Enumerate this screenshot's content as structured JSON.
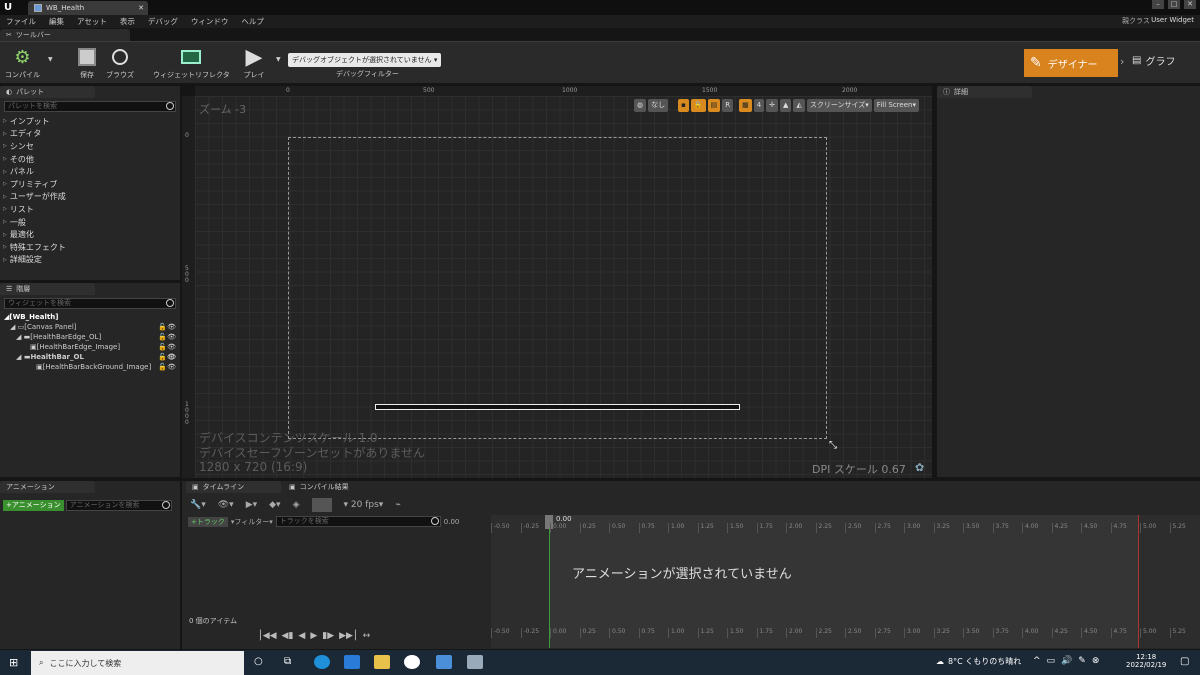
{
  "window": {
    "tab_title": "WB_Health",
    "parent_class": "親クラス",
    "user_widget": "User Widget",
    "controls": [
      "–",
      "□",
      "✕"
    ]
  },
  "menu": [
    "ファイル",
    "編集",
    "アセット",
    "表示",
    "デバッグ",
    "ウィンドウ",
    "ヘルプ"
  ],
  "toolbar": {
    "header": "ツールバー",
    "compile": "コンパイル",
    "save": "保存",
    "browse": "ブラウズ",
    "reflector": "ウィジェットリフレクタ",
    "play": "プレイ",
    "debug_select": "デバッグオブジェクトが選択されていません",
    "debug_filter": "デバッグフィルター",
    "designer": "デザイナー",
    "graph": "グラフ"
  },
  "palette": {
    "title": "パレット",
    "search_placeholder": "パレットを検索",
    "categories": [
      "インプット",
      "エディタ",
      "シンセ",
      "その他",
      "パネル",
      "プリミティブ",
      "ユーザーが作成",
      "リスト",
      "一般",
      "最適化",
      "特殊エフェクト",
      "詳細設定"
    ]
  },
  "hierarchy": {
    "title": "階層",
    "search_placeholder": "ウィジェットを検索",
    "items": [
      "[WB_Health]",
      "[Canvas Panel]",
      "[HealthBarEdge_OL]",
      "[HealthBarEdge_Image]",
      "HealthBar_OL",
      "[HealthBarBackGround_Image]"
    ]
  },
  "canvas": {
    "zoom": "ズーム -3",
    "ruler_x": [
      "0",
      "500",
      "1000",
      "1500",
      "2000"
    ],
    "ruler_y": [
      "0",
      "500",
      "1000"
    ],
    "content_scale": "デバイスコンテンツスケール 1.0",
    "safe_zone": "デバイスセーフゾーンセットがありません",
    "resolution": "1280 x 720 (16:9)",
    "dpi": "DPI スケール 0.67",
    "none": "なし",
    "r_label": "R",
    "count": "4",
    "screen_size": "スクリーンサイズ",
    "fill_screen": "Fill Screen"
  },
  "details": {
    "title": "詳細"
  },
  "animations": {
    "title": "アニメーション",
    "add_button": "+アニメーション",
    "search_placeholder": "アニメーションを検索"
  },
  "timeline": {
    "tab_timeline": "タイムライン",
    "tab_compile": "コンパイル結果",
    "fps": "20 fps",
    "track": "+トラック",
    "filter": "フィルター",
    "track_search": "トラックを検索",
    "time": "0.00",
    "current": "0.00",
    "items": "0 個のアイテム",
    "no_anim": "アニメーションが選択されていません",
    "ticks": [
      "-0.50",
      "-0.25",
      "0.00",
      "0.25",
      "0.50",
      "0.75",
      "1.00",
      "1.25",
      "1.50",
      "1.75",
      "2.00",
      "2.25",
      "2.50",
      "2.75",
      "3.00",
      "3.25",
      "3.50",
      "3.75",
      "4.00",
      "4.25",
      "4.50",
      "4.75",
      "5.00",
      "5.25"
    ]
  },
  "taskbar": {
    "search": "ここに入力して検索",
    "weather": "8°C くもりのち晴れ",
    "time": "12:18",
    "date": "2022/02/19"
  }
}
